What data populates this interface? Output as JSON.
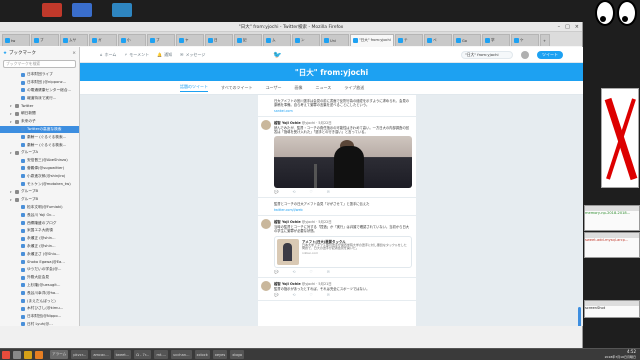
{
  "window": {
    "title": "\"日大\" from:yjochi - Twitter検索 - Mozilla Firefox",
    "tabs": [
      "tw",
      "ブ",
      "ムサ",
      "ガ",
      "小",
      "ブ",
      "ヤ",
      "日",
      "記",
      "ム",
      "ン",
      "Uni",
      "\"日大\" from:yjochi",
      "テ",
      "ペ",
      "Go",
      "学",
      "ケ",
      "+"
    ],
    "url": "https://twitter.com/search?f=tweets&q=\"日大\" from:yjochi",
    "identity": "Twitter, Inc. (US)",
    "zoom": "67%",
    "search_placeholder": "検索"
  },
  "bookmarks_bar": [
    "よく見るページ",
    "Googleツールバー",
    "ブックマーク",
    "Twitter",
    "ブログ",
    "ムサシノ",
    "メモ",
    "Firefox",
    "グーグルニュース",
    "よく使う",
    "ニュース",
    "Wikipedia",
    "翻訳"
  ],
  "sidebar": {
    "title": "ブックマーク",
    "search_placeholder": "ブックマークを検索",
    "items": [
      {
        "label": "日本財団ライブ",
        "type": "page",
        "depth": 2
      },
      {
        "label": "日本財団 (@nipponz...",
        "type": "page",
        "depth": 2
      },
      {
        "label": "の電通健康センター総合...",
        "type": "page",
        "depth": 2
      },
      {
        "label": "報道特派で実行...",
        "type": "page",
        "depth": 2
      },
      {
        "label": "Twitter",
        "type": "folder",
        "depth": 1
      },
      {
        "label": "朝日新聞",
        "type": "folder",
        "depth": 1
      },
      {
        "label": "未来の子",
        "type": "folder",
        "depth": 1
      },
      {
        "label": "Twitterの高度な検索",
        "type": "page",
        "depth": 2,
        "selected": true
      },
      {
        "label": "秦鯨一 (ぐるぐる検索...",
        "type": "page",
        "depth": 2
      },
      {
        "label": "秦鯨一 (ぐるぐる検索...",
        "type": "page",
        "depth": 2
      },
      {
        "label": "グループA",
        "type": "folder",
        "depth": 1
      },
      {
        "label": "安倍晋三(@AbeShinzo)",
        "type": "page",
        "depth": 2
      },
      {
        "label": "菅義偉(@sugawitter)",
        "type": "page",
        "depth": 2
      },
      {
        "label": "小泉進次郎(@shinjiro)",
        "type": "page",
        "depth": 2
      },
      {
        "label": "モトケン(@motoken_tw)",
        "type": "page",
        "depth": 2
      },
      {
        "label": "グループB",
        "type": "folder",
        "depth": 1
      },
      {
        "label": "グループB",
        "type": "folder",
        "depth": 1
      },
      {
        "label": "松本文明(@Fumiaki)",
        "type": "page",
        "depth": 2
      },
      {
        "label": "長谷川 Yoji Oc...",
        "type": "page",
        "depth": 2
      },
      {
        "label": "西郷隆盛のブログ",
        "type": "page",
        "depth": 2
      },
      {
        "label": "米国エネ大統領",
        "type": "page",
        "depth": 2
      },
      {
        "label": "永瀬正 (@shin...",
        "type": "page",
        "depth": 2
      },
      {
        "label": "永瀬正 (@shin...",
        "type": "page",
        "depth": 2
      },
      {
        "label": "永瀬正さ (@Shiu...",
        "type": "page",
        "depth": 2
      },
      {
        "label": "Shoko Egawa(@Ea...",
        "type": "page",
        "depth": 2
      },
      {
        "label": "ゆうだいの学会(@...",
        "type": "page",
        "depth": 2
      },
      {
        "label": "外務大臣会見",
        "type": "page",
        "depth": 2
      },
      {
        "label": "上杉隆(@uesugit...",
        "type": "page",
        "depth": 2
      },
      {
        "label": "長谷川幸洋(@ha...",
        "type": "page",
        "depth": 2
      },
      {
        "label": "(まえだんぼっと)",
        "type": "page",
        "depth": 2
      },
      {
        "label": "木村ひさし(@kimu...",
        "type": "page",
        "depth": 2
      },
      {
        "label": "日本財団(@Nippo...",
        "type": "page",
        "depth": 2
      },
      {
        "label": "日村 Lyuh(@...",
        "type": "page",
        "depth": 2
      },
      {
        "label": "郷原信郎(@nobuo...",
        "type": "page",
        "depth": 2
      },
      {
        "label": "yokosuka(@...",
        "type": "page",
        "depth": 2
      },
      {
        "label": "田原総一朗(@den...",
        "type": "page",
        "depth": 2
      },
      {
        "label": "日本テレビ(@ntv_...",
        "type": "page",
        "depth": 2
      },
      {
        "label": "日本テレビ(@ntv_...",
        "type": "page",
        "depth": 2
      },
      {
        "label": "Miho(@ahokora)",
        "type": "page",
        "depth": 2
      }
    ]
  },
  "twitter": {
    "nav": [
      "ホーム",
      "モーメント",
      "通知",
      "メッセージ"
    ],
    "search_value": "\"日大\" from:yjochi",
    "tweet_button": "ツイート",
    "hero_title": "\"日大\" from:yjochi",
    "tabs": [
      "話題のツイート",
      "すべてのツイート",
      "ユーザー",
      "画像",
      "ニュース",
      "ライブ放送"
    ],
    "active_tab": 0,
    "tweets": [
      {
        "author": "",
        "handle": "",
        "time": "",
        "text": "日大アメフトの宮川選手は会見の前に書面で反則行為の経緯を示すように求められ、会見の原稿を準備。自ら考えて謝罪の言葉を述べることにしたという。",
        "link": "sankei.com",
        "card": null,
        "photo": false
      },
      {
        "author": "越智 Yoji Ochie",
        "handle": "@yjochi · 5月22日",
        "time": "5月22日",
        "text": "読んでみたが、監督・コーチの責任指示の可能性はきわめて高い。一方日大の内部調査の回答は「指導を受け入れた」「選手との行き違い」と言っている。",
        "link": "",
        "card": null,
        "photo": true
      },
      {
        "author": "",
        "handle": "",
        "time": "",
        "text": "監督とコーチの日大アメフト会見「けがさせて」と選手に伝えた",
        "link": "twitter.com/i/web",
        "card": null,
        "photo": false
      },
      {
        "author": "越智 Yoji Ochie",
        "handle": "@yjochi · 5月22日",
        "time": "5月22日",
        "text": "当時の監督とコーチに対する「捏造」か「実行」は弁護で確認されていない。当初から日大の学生に謝罪が必要な状態。",
        "link": "",
        "card": {
          "title": "アメフト(日大)悪質タックル",
          "desc": "日本大学アメフト部の選手が関西学院大学の選手に対し悪質なタックルをした問題で、日大の選手が記者会見を開いた。",
          "domain": "nikkei.com"
        },
        "photo": false
      },
      {
        "author": "越智 Yoji Ochie",
        "handle": "@yjochi · 5月21日",
        "time": "5月21日",
        "text": "監督の指示があったとすれば、それは完全にスポーツではない。",
        "link": "",
        "card": null,
        "photo": false
      }
    ]
  },
  "right_windows": [
    "memory-np-2018-2018...",
    "sweet-add-mysql-arcp...",
    "screenShot"
  ],
  "taskbar": {
    "tasks": [
      "アラーム",
      "pkvcr...",
      "amcac...",
      "tweet...",
      "Ω - 7r...",
      "mt-...",
      "ucchan...",
      "xclock",
      "xeyes",
      "xlogo"
    ],
    "time": "4:52",
    "date": "2018年7月16日月曜日"
  }
}
